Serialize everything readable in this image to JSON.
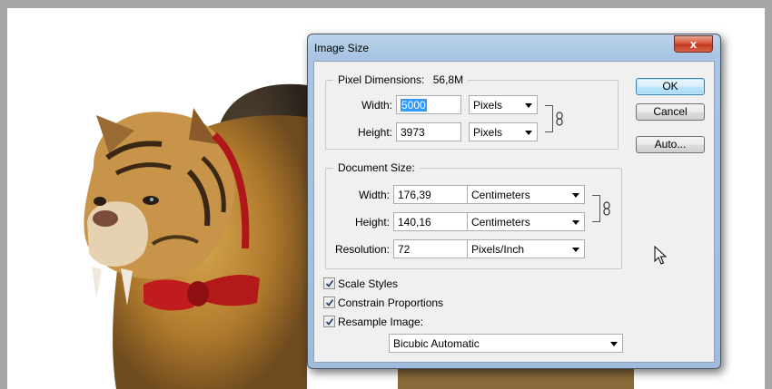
{
  "dialog": {
    "title": "Image Size",
    "close_label": "x"
  },
  "pixel_dimensions": {
    "legend": "Pixel Dimensions:",
    "size": "56,8M",
    "width_label": "Width:",
    "width_value": "5000",
    "width_unit": "Pixels",
    "height_label": "Height:",
    "height_value": "3973",
    "height_unit": "Pixels"
  },
  "document_size": {
    "legend": "Document Size:",
    "width_label": "Width:",
    "width_value": "176,39",
    "width_unit": "Centimeters",
    "height_label": "Height:",
    "height_value": "140,16",
    "height_unit": "Centimeters",
    "resolution_label": "Resolution:",
    "resolution_value": "72",
    "resolution_unit": "Pixels/Inch"
  },
  "buttons": {
    "ok": "OK",
    "cancel": "Cancel",
    "auto": "Auto..."
  },
  "options": {
    "scale_styles": {
      "label": "Scale Styles",
      "checked": true
    },
    "constrain_proportions": {
      "label": "Constrain Proportions",
      "checked": true
    },
    "resample_image": {
      "label": "Resample Image:",
      "checked": true
    },
    "resample_method": "Bicubic Automatic"
  },
  "icons": {
    "chain": "chain-link-icon",
    "cursor": "mouse-pointer-icon"
  },
  "colors": {
    "title_gradient": "#a9c5e3",
    "close_red": "#c23a20",
    "selection": "#3399ff",
    "default_button": "#3c7fb1"
  }
}
